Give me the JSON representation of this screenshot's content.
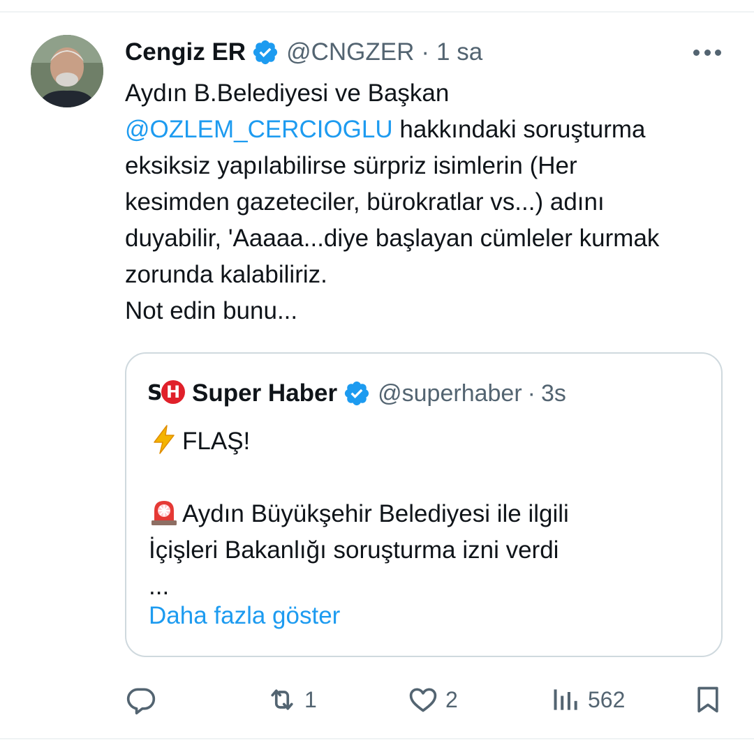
{
  "tweet": {
    "author_name": "Cengiz ER",
    "author_handle": "@CNGZER",
    "separator": "·",
    "time": "1 sa",
    "text_lines": [
      {
        "text": "Aydın B.Belediyesi ve Başkan"
      },
      {
        "mention": "@OZLEM_CERCIOGLU",
        "text": " hakkındaki soruşturma"
      },
      {
        "text": "eksiksiz yapılabilirse sürpriz isimlerin (Her"
      },
      {
        "text": "kesimden gazeteciler, bürokratlar vs...) adını"
      },
      {
        "text": "duyabilir, 'Aaaaa...diye başlayan cümleler kurmak"
      },
      {
        "text": "zorunda kalabiliriz."
      },
      {
        "text": "Not edin bunu..."
      }
    ]
  },
  "quote": {
    "logo_text_s": "S",
    "logo_text_h": "H",
    "author_name": "Super Haber",
    "author_handle": "@superhaber",
    "separator": "·",
    "time": "3s",
    "line_1": "FLAŞ!",
    "line_2": "Aydın Büyükşehir Belediyesi ile ilgili",
    "line_3": "İçişleri Bakanlığı soruşturma izni verdi",
    "line_4": "...",
    "show_more": "Daha fazla göster"
  },
  "actions": {
    "reply_count": "",
    "retweet_count": "1",
    "like_count": "2",
    "views_count": "562"
  },
  "colors": {
    "accent": "#1d9bf0",
    "muted": "#536471",
    "text": "#0f1419",
    "border": "#cfd9de",
    "logo_red": "#e0202a"
  },
  "icons": [
    "verified-badge-icon",
    "more-icon",
    "lightning-emoji",
    "siren-emoji",
    "reply-icon",
    "retweet-icon",
    "like-icon",
    "views-icon",
    "bookmark-icon"
  ]
}
